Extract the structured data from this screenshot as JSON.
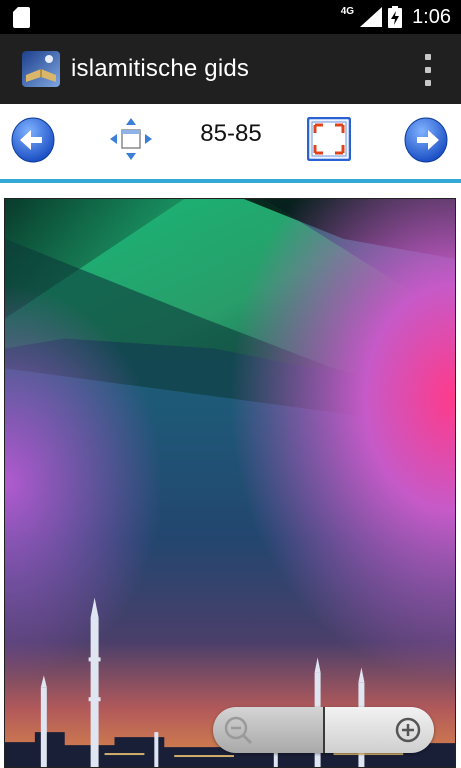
{
  "status_bar": {
    "network": "4G",
    "time": "1:06",
    "icons": [
      "sd-card-icon",
      "signal-icon",
      "battery-charging-icon"
    ]
  },
  "action_bar": {
    "title": "islamitische gids",
    "icons": [
      "app-icon",
      "overflow-menu-icon"
    ]
  },
  "toolbar": {
    "page_indicator": "85-85",
    "icons": [
      "back-arrow-icon",
      "move-arrows-icon",
      "fit-screen-icon",
      "forward-arrow-icon"
    ]
  },
  "colors": {
    "status_bar": "#000000",
    "action_bar": "#202020",
    "divider": "#34a8d6",
    "nav_button": "#2a62d4",
    "fit_button_border": "#2a62d4",
    "fit_button_corners": "#e0441c"
  },
  "zoom_controls": {
    "icons": [
      "zoom-out-icon",
      "zoom-in-icon"
    ]
  }
}
